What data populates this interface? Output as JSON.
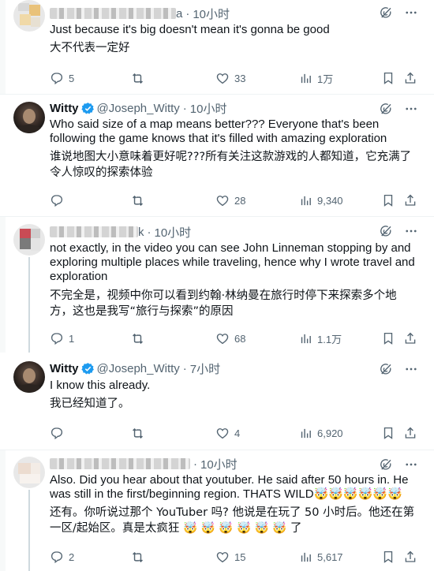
{
  "tweets": [
    {
      "display_name": "",
      "handle": "a",
      "time": "10小时",
      "text": "Just because it's big doesn't mean it's gonna be good",
      "translation": "大不代表一定好",
      "replies": "5",
      "likes": "33",
      "views": "1万"
    },
    {
      "display_name": "Witty",
      "handle": "@Joseph_Witty",
      "time": "10小时",
      "text": "Who said size of a map means better??? Everyone that's been following the game knows that it's filled with amazing exploration",
      "translation": "谁说地图大小意味着更好呢???所有关注这款游戏的人都知道，它充满了令人惊叹的探索体验",
      "replies": "",
      "likes": "28",
      "views": "9,340"
    },
    {
      "display_name": "",
      "handle": "k",
      "time": "10小时",
      "text": "not exactly, in the video you can see John Linneman stopping by and exploring multiple places while traveling, hence why I wrote travel and exploration",
      "translation": "不完全是，视频中你可以看到约翰·林纳曼在旅行时停下来探索多个地方，这也是我写“旅行与探索”的原因",
      "replies": "1",
      "likes": "68",
      "views": "1.1万"
    },
    {
      "display_name": "Witty",
      "handle": "@Joseph_Witty",
      "time": "7小时",
      "text": "I know this already.",
      "translation": "我已经知道了。",
      "replies": "",
      "likes": "4",
      "views": "6,920"
    },
    {
      "display_name": "",
      "handle": "",
      "time": "10小时",
      "text": "Also. Did you hear about that youtuber. He said after 50 hours in.  He was still in the first/beginning region. THATS WILD🤯🤯🤯🤯🤯🤯",
      "translation": "还有。你听说过那个 YouTuber 吗? 他说是在玩了 50 小时后。他还在第一区/起始区。真是太疯狂 🤯 🤯 🤯 🤯 🤯 🤯 了",
      "replies": "2",
      "likes": "15",
      "views": "5,617"
    }
  ],
  "separator_dot": "·",
  "colors": {
    "verified": "#1d9bf0",
    "text": "#0f1419",
    "muted": "#536471",
    "line": "#cfd9de"
  },
  "icons": [
    "grok-icon",
    "more-icon",
    "reply-icon",
    "retweet-icon",
    "like-icon",
    "views-icon",
    "bookmark-icon",
    "share-icon",
    "verified-badge-icon"
  ]
}
